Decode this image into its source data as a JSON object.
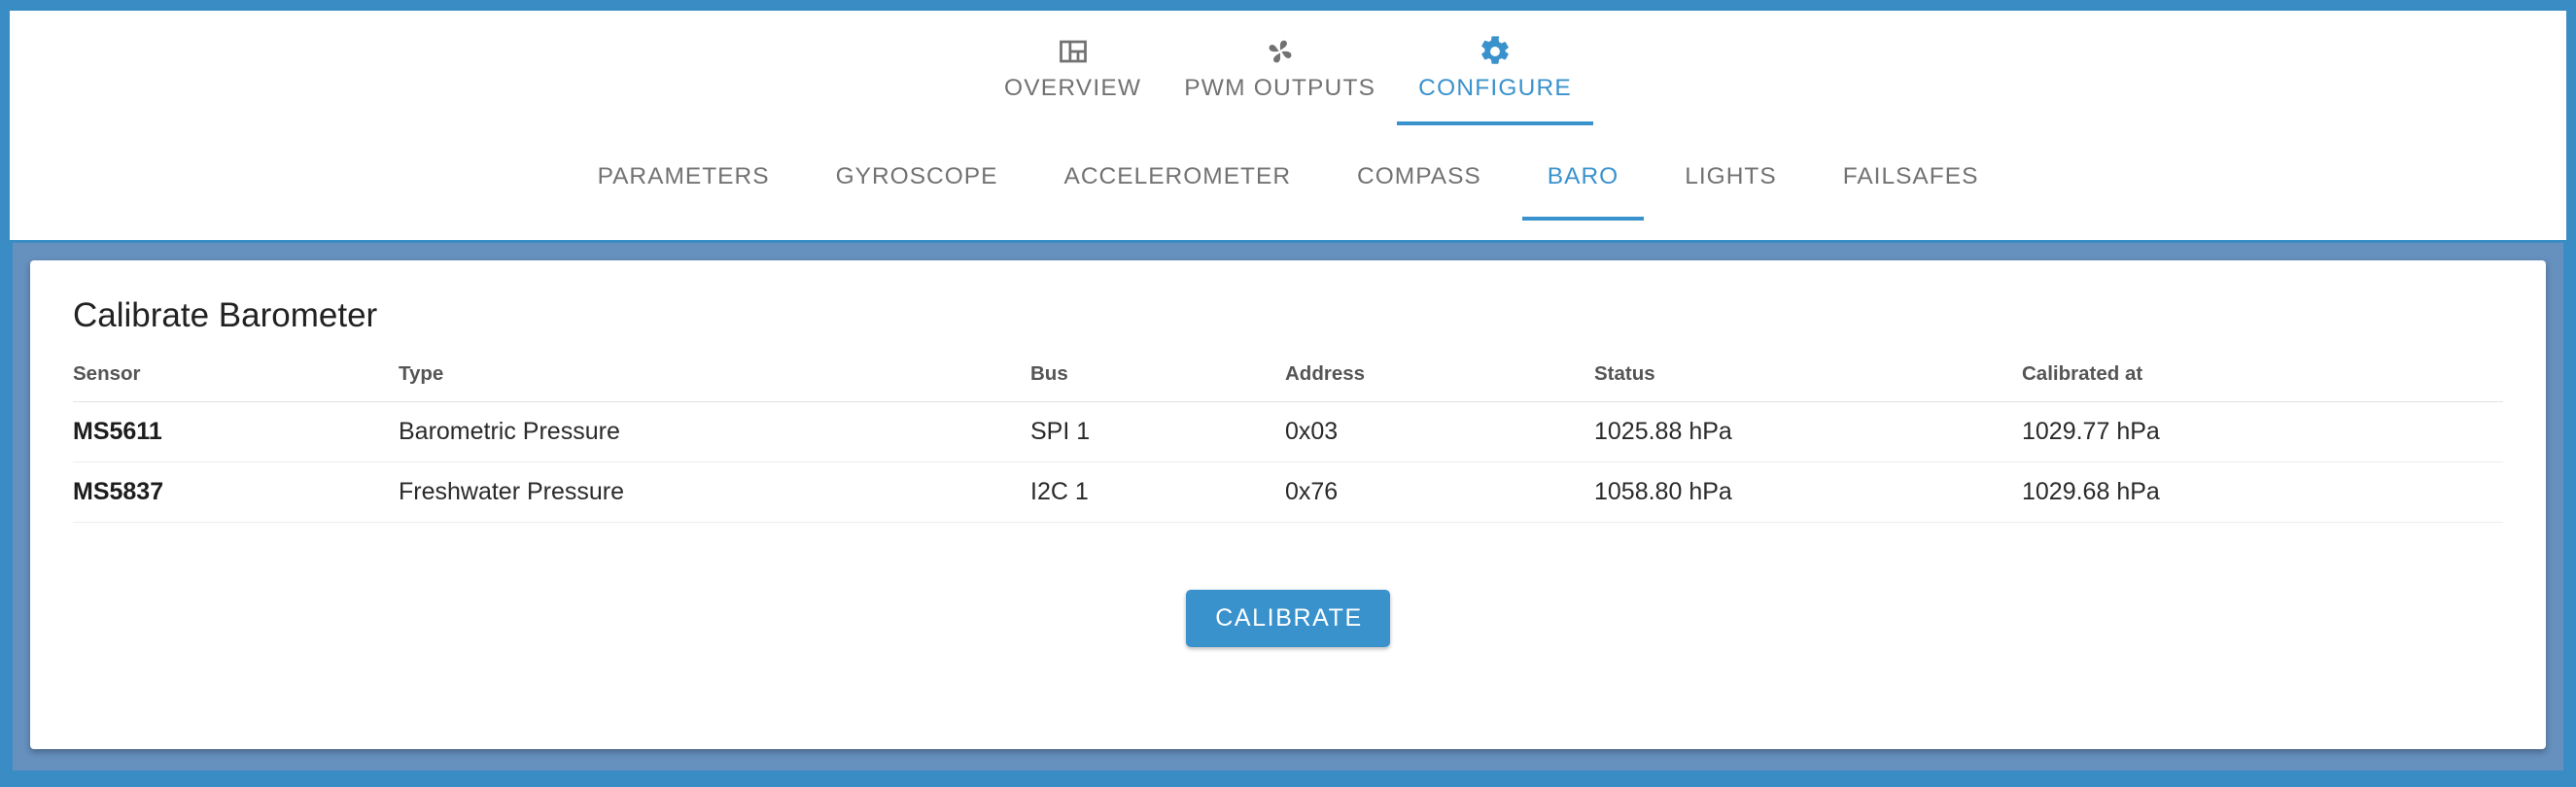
{
  "theme": {
    "frame_color": "#3a8dc4",
    "panel_color": "#6690be",
    "accent_color": "#3a92cd",
    "muted_text_color": "#727272",
    "card_background": "#ffffff"
  },
  "primary_nav": {
    "items": [
      {
        "label": "OVERVIEW",
        "icon": "dashboard-grid-icon",
        "active": false
      },
      {
        "label": "PWM OUTPUTS",
        "icon": "propeller-icon",
        "active": false
      },
      {
        "label": "CONFIGURE",
        "icon": "gear-icon",
        "active": true
      }
    ]
  },
  "secondary_nav": {
    "items": [
      {
        "label": "PARAMETERS",
        "active": false
      },
      {
        "label": "GYROSCOPE",
        "active": false
      },
      {
        "label": "ACCELEROMETER",
        "active": false
      },
      {
        "label": "COMPASS",
        "active": false
      },
      {
        "label": "BARO",
        "active": true
      },
      {
        "label": "LIGHTS",
        "active": false
      },
      {
        "label": "FAILSAFES",
        "active": false
      }
    ]
  },
  "card": {
    "title": "Calibrate Barometer",
    "table": {
      "columns": [
        "Sensor",
        "Type",
        "Bus",
        "Address",
        "Status",
        "Calibrated at"
      ],
      "rows": [
        {
          "sensor": "MS5611",
          "type": "Barometric Pressure",
          "bus": "SPI 1",
          "address": "0x03",
          "status": "1025.88 hPa",
          "calibrated_at": "1029.77 hPa"
        },
        {
          "sensor": "MS5837",
          "type": "Freshwater Pressure",
          "bus": "I2C 1",
          "address": "0x76",
          "status": "1058.80 hPa",
          "calibrated_at": "1029.68 hPa"
        }
      ]
    },
    "calibrate_button_label": "CALIBRATE"
  }
}
